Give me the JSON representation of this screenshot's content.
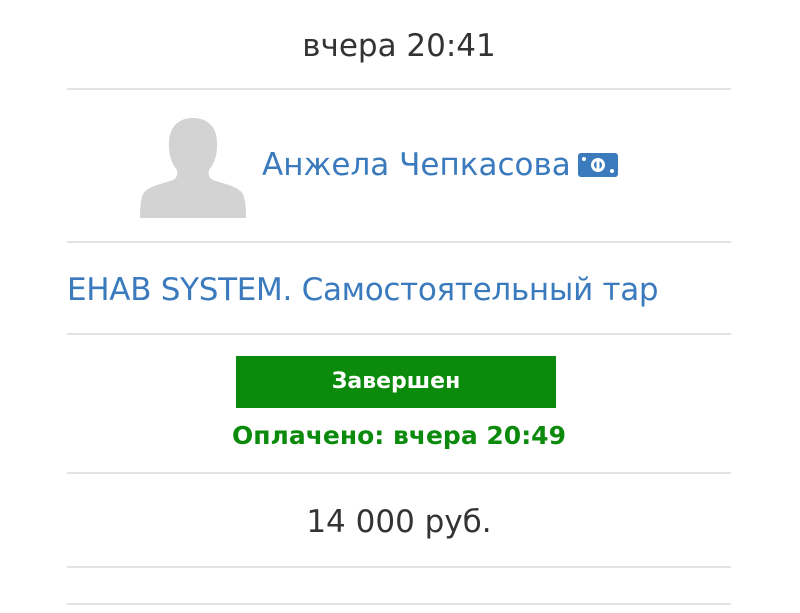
{
  "order": {
    "date": "вчера 20:41",
    "client": {
      "name": "Анжела Чепкасова",
      "avatar_icon": "default-user-avatar-icon",
      "payment_icon": "cash-money-icon"
    },
    "product": "EHAB SYSTEM. Самостоятельный тар",
    "status": {
      "label": "Завершен",
      "paid_text": "Оплачено: вчера 20:49"
    },
    "amount": "14 000 руб."
  },
  "colors": {
    "link": "#3a7abd",
    "status_green": "#0b8a0b",
    "divider": "#e3e3e3",
    "text": "#333333",
    "avatar": "#d3d3d3"
  }
}
